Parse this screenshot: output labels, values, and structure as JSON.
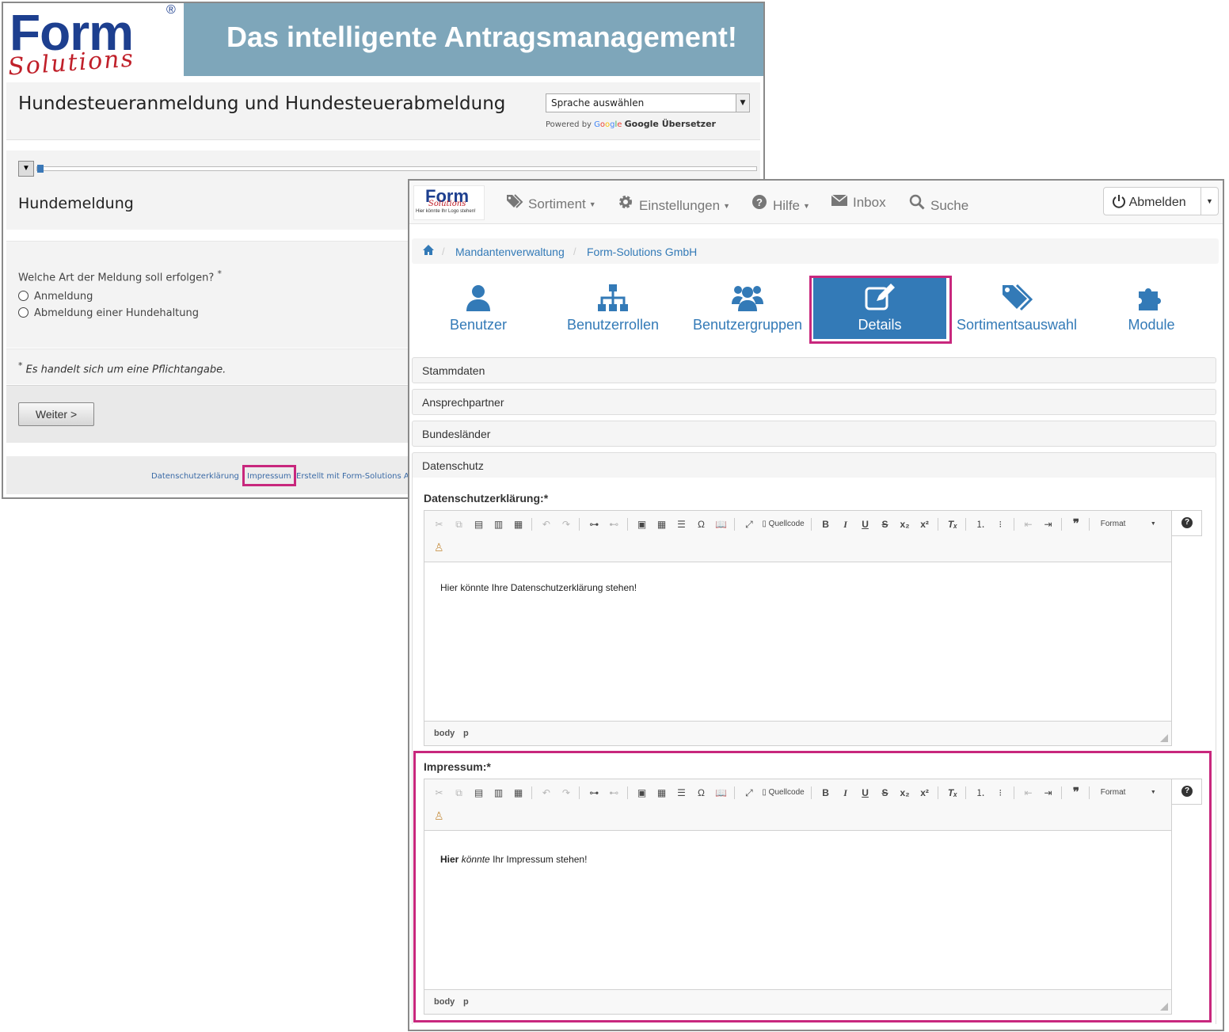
{
  "back_window": {
    "logo": {
      "word": "Form",
      "sub": "Solutions",
      "reg": "®"
    },
    "banner": "Das intelligente Antragsmanagement!",
    "form_title": "Hundesteueranmeldung und Hundesteuerabmeldung",
    "language_select": "Sprache auswählen",
    "powered_by": "Powered by",
    "google_brand": [
      "G",
      "o",
      "o",
      "g",
      "l",
      "e"
    ],
    "google_translate": "Google Übersetzer",
    "section_title": "Hundemeldung",
    "question": "Welche Art der Meldung soll erfolgen?",
    "required_mark": "*",
    "options": [
      "Anmeldung",
      "Abmeldung einer Hundehaltung"
    ],
    "required_note": "Es handelt sich um eine Pflichtangabe.",
    "next_button": "Weiter >",
    "footer_links": [
      "Datenschutzerklärung",
      "Impressum",
      "Erstellt mit Form-Solutions A"
    ]
  },
  "front_window": {
    "logo": {
      "word": "Form",
      "sub": "Solutions",
      "tagline": "Hier könnte Ihr Logo stehen!"
    },
    "nav": [
      {
        "label": "Sortiment",
        "icon": "tags-icon",
        "has_caret": true
      },
      {
        "label": "Einstellungen",
        "icon": "gear-icon",
        "has_caret": true
      },
      {
        "label": "Hilfe",
        "icon": "question-circle-icon",
        "has_caret": true
      },
      {
        "label": "Inbox",
        "icon": "envelope-icon",
        "has_caret": false
      },
      {
        "label": "Suche",
        "icon": "search-icon",
        "has_caret": false
      }
    ],
    "logout": "Abmelden",
    "breadcrumb": [
      "Mandantenverwaltung",
      "Form-Solutions GmbH"
    ],
    "tiles": [
      {
        "label": "Benutzer",
        "icon": "user-icon"
      },
      {
        "label": "Benutzerrollen",
        "icon": "sitemap-icon"
      },
      {
        "label": "Benutzergruppen",
        "icon": "users-icon"
      },
      {
        "label": "Details",
        "icon": "edit-icon",
        "active": true
      },
      {
        "label": "Sortimentsauswahl",
        "icon": "tags-icon"
      },
      {
        "label": "Module",
        "icon": "puzzle-icon"
      }
    ],
    "accordions": [
      "Stammdaten",
      "Ansprechpartner",
      "Bundesländer",
      "Datenschutz"
    ],
    "editors": [
      {
        "label": "Datenschutzerklärung:*",
        "content_plain": "Hier könnte Ihre Datenschutzerklärung stehen!",
        "path": [
          "body",
          "p"
        ]
      },
      {
        "label": "Impressum:*",
        "content_bold": "Hier",
        "content_italic": "könnte",
        "content_rest": "Ihr Impressum stehen!",
        "path": [
          "body",
          "p"
        ]
      }
    ],
    "toolbar": {
      "source": "Quellcode",
      "format": "Format"
    },
    "accent_color": "#337ab7",
    "highlight_color": "#c8277d"
  }
}
